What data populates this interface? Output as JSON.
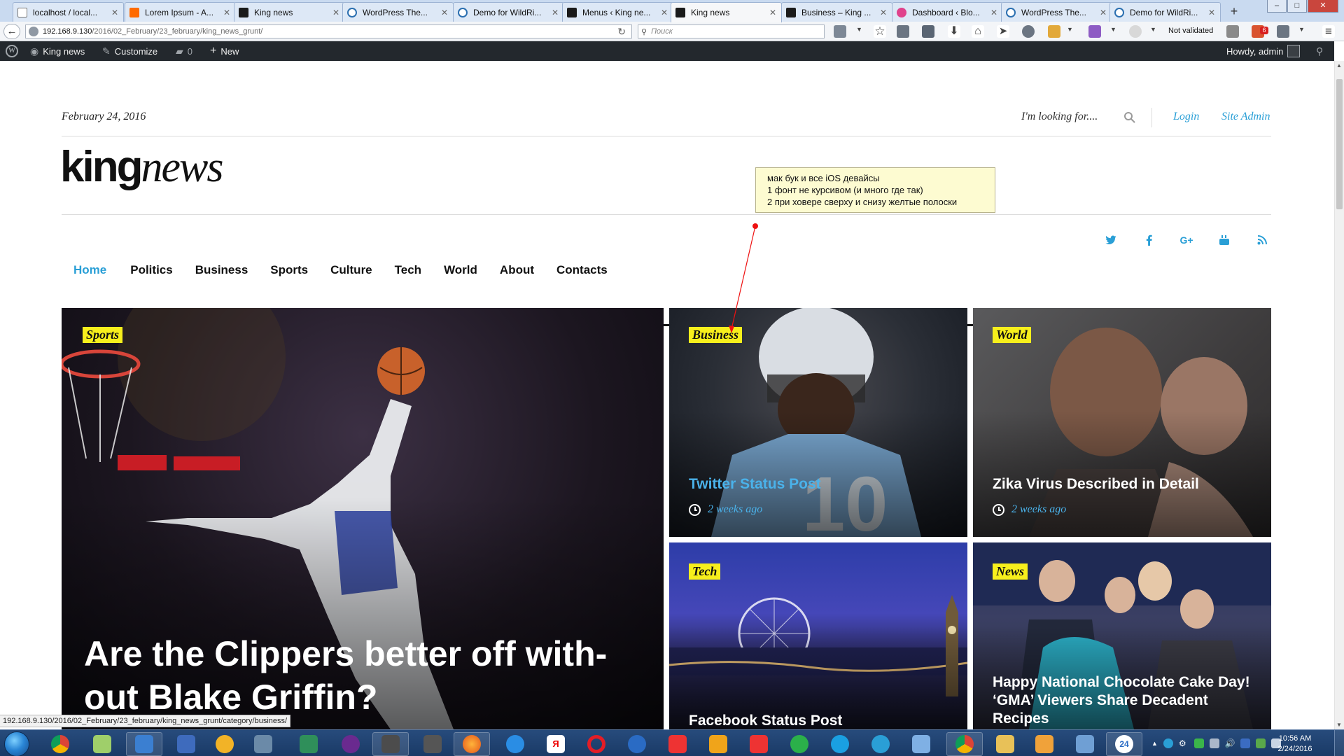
{
  "browser": {
    "tabs": [
      {
        "title": "localhost / local...",
        "fav": "ph"
      },
      {
        "title": "Lorem Ipsum - A...",
        "fav": "lo"
      },
      {
        "title": "King news",
        "fav": "kn"
      },
      {
        "title": "WordPress The...",
        "fav": "wp"
      },
      {
        "title": "Demo for WildRi...",
        "fav": "wp"
      },
      {
        "title": "Menus ‹ King ne...",
        "fav": "kn"
      },
      {
        "title": "King news",
        "fav": "kn",
        "active": true
      },
      {
        "title": "Business – King ...",
        "fav": "kn"
      },
      {
        "title": "Dashboard ‹ Blo...",
        "fav": "fl"
      },
      {
        "title": "WordPress The...",
        "fav": "wp"
      },
      {
        "title": "Demo for WildRi...",
        "fav": "wp"
      }
    ],
    "new_tab_label": "+",
    "url_host": "192.168.9.130",
    "url_path": "/2016/02_February/23_february/king_news_grunt/",
    "search_placeholder": "Поиск",
    "not_validated": "Not validated",
    "badge_count": "6"
  },
  "wpbar": {
    "site_name": "King news",
    "customize": "Customize",
    "comments": "0",
    "new": "New",
    "howdy": "Howdy, admin"
  },
  "header": {
    "date": "February 24, 2016",
    "search_label": "I'm looking for....",
    "login": "Login",
    "site_admin": "Site Admin",
    "logo_bold": "king",
    "logo_italic": "news"
  },
  "menu": [
    "Home",
    "Politics",
    "Business",
    "Sports",
    "Culture",
    "Tech",
    "World",
    "About",
    "Contacts"
  ],
  "social": [
    "twitter-icon",
    "facebook-icon",
    "google-plus-icon",
    "youtube-icon",
    "rss-icon"
  ],
  "note": {
    "line1": "мак бук и все iOS девайсы",
    "line2": "1 фонт не курсивом (и много где так)",
    "line3": "2 при ховере сверху и снизу желтые полоски"
  },
  "cards": [
    {
      "category": "Sports",
      "title": "Are the Clippers better off with-out Blake Griffin?"
    },
    {
      "category": "Business",
      "title": "Twitter Status Post",
      "time": "2 weeks ago"
    },
    {
      "category": "World",
      "title": "Zika Virus Described in Detail",
      "time": "2 weeks ago"
    },
    {
      "category": "Tech",
      "title": "Facebook Status Post"
    },
    {
      "category": "News",
      "title": "Happy National Chocolate Cake Day! ‘GMA’ Viewers Share Decadent Recipes"
    }
  ],
  "status_url": "192.168.9.130/2016/02_February/23_february/king_news_grunt/category/business/",
  "taskbar": {
    "time": "10:56 AM",
    "date": "2/24/2016"
  },
  "colors": {
    "accent": "#2a9fd6",
    "category_bg": "#f7ef1c",
    "wpbar_bg": "#23282d"
  }
}
